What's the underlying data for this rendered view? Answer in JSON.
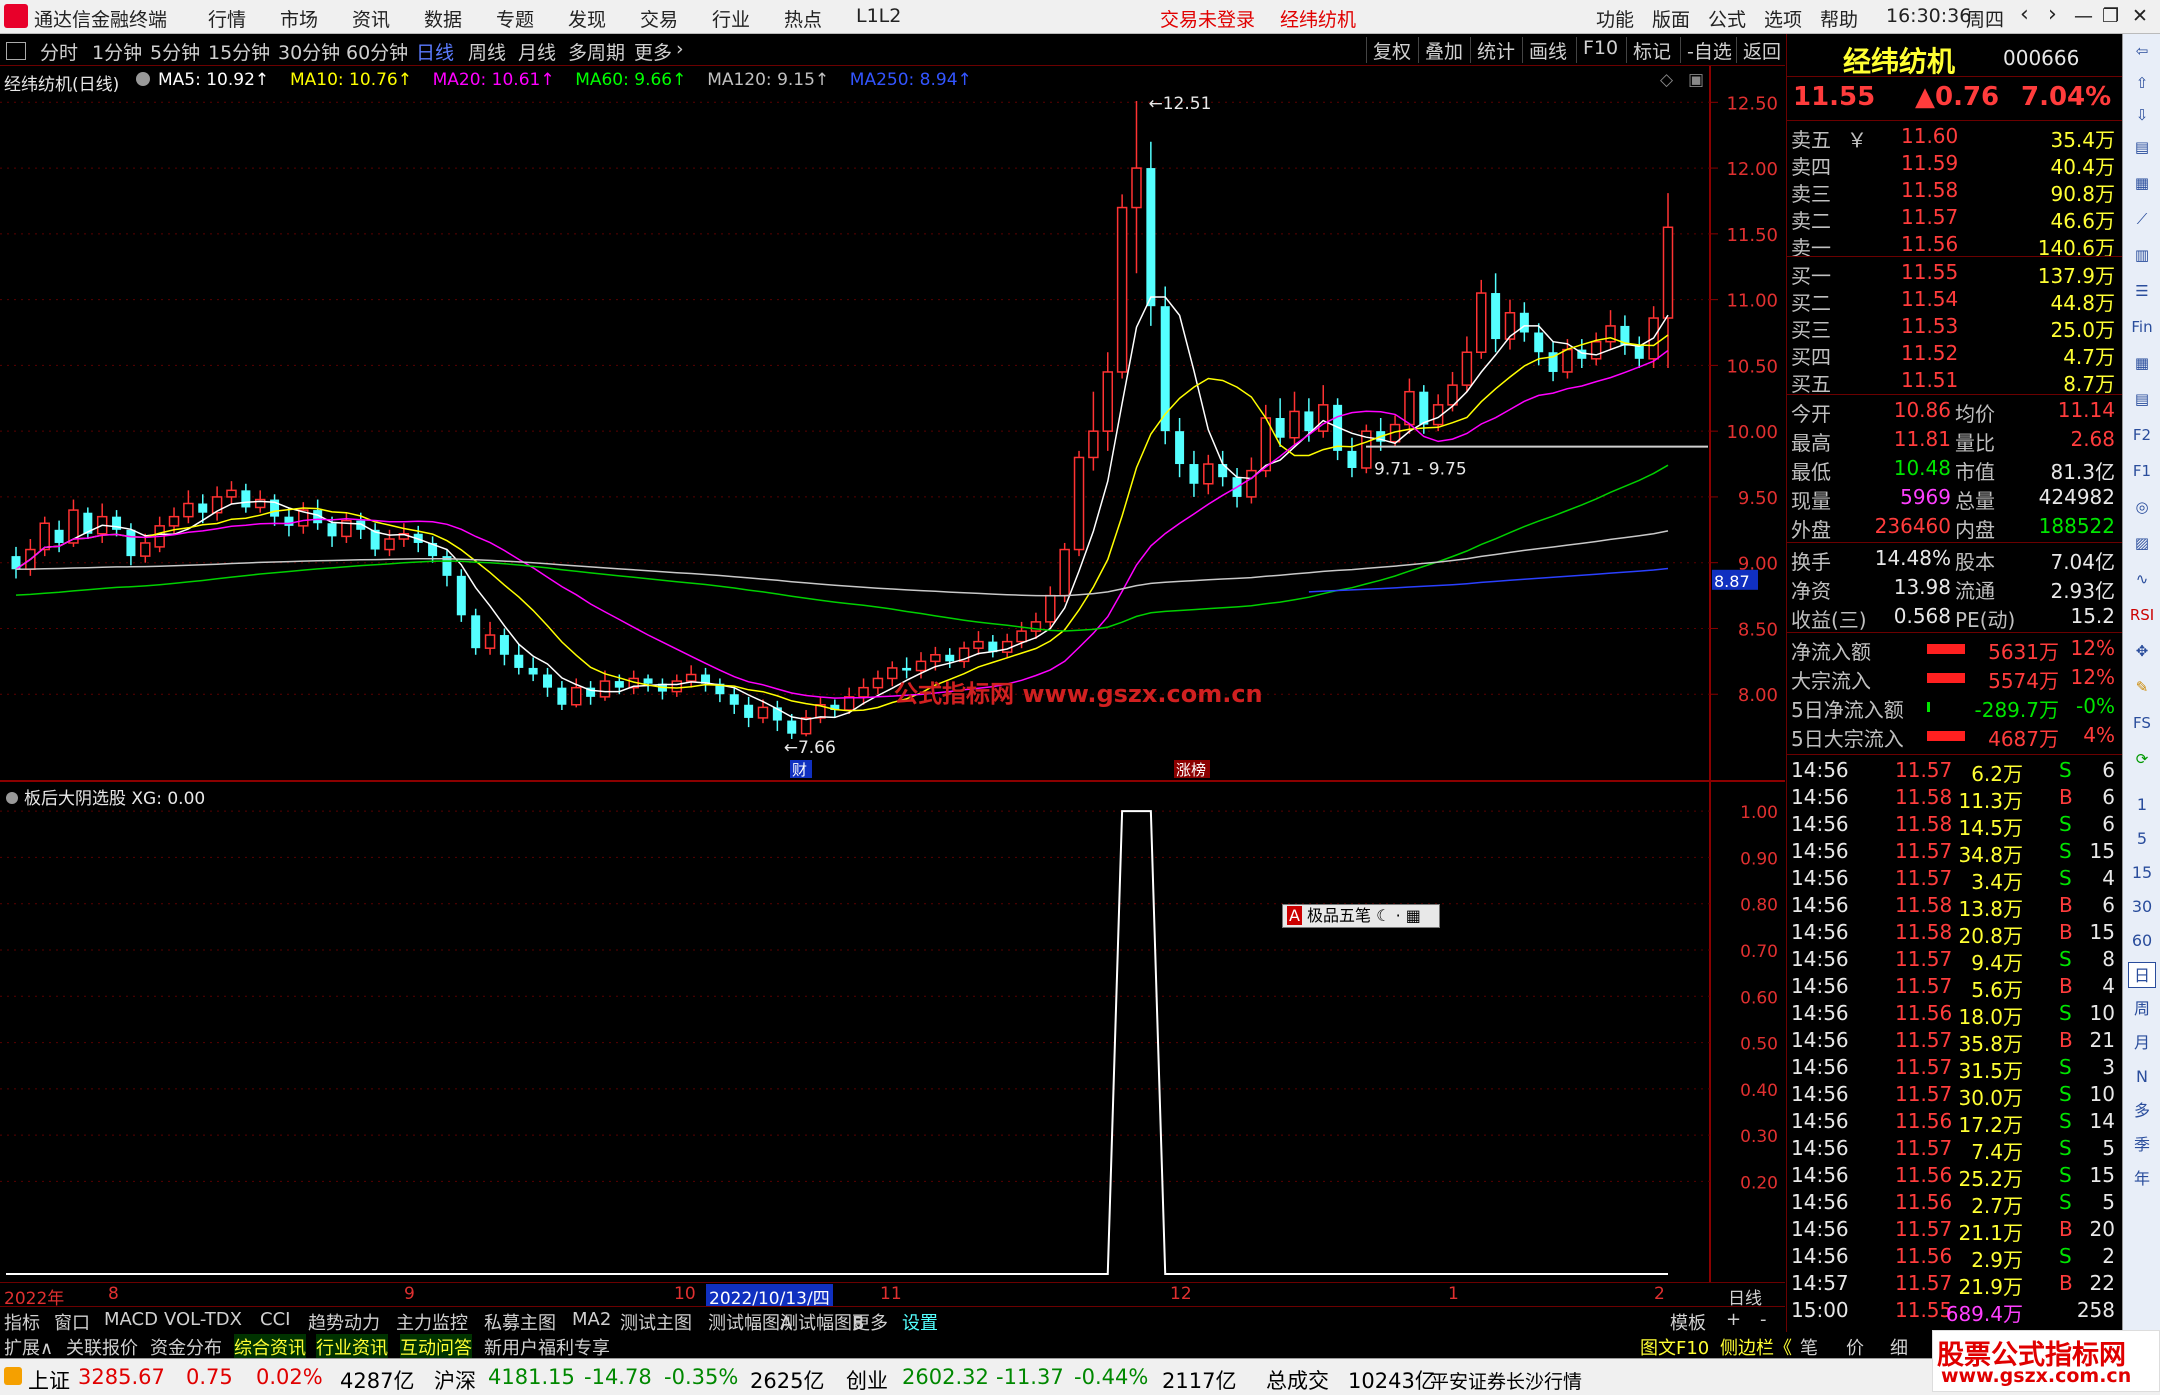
{
  "menubar": {
    "app_title": "通达信金融终端",
    "items": [
      "行情",
      "市场",
      "资讯",
      "数据",
      "专题",
      "发现",
      "交易",
      "行业",
      "热点",
      "L1L2"
    ],
    "trade_status": "交易未登录",
    "current_stock": "经纬纺机",
    "right_items": [
      "功能",
      "版面",
      "公式",
      "选项",
      "帮助"
    ],
    "time": "16:30:36",
    "weekday": "周四"
  },
  "periodbar": {
    "periods": [
      "分时",
      "1分钟",
      "5分钟",
      "15分钟",
      "30分钟",
      "60分钟",
      "日线",
      "周线",
      "月线",
      "多周期",
      "更多"
    ],
    "active": "日线",
    "tools": [
      "复权",
      "叠加",
      "统计",
      "画线",
      "F10",
      "标记",
      "-自选",
      "返回"
    ]
  },
  "main_chart": {
    "legend_name": "经纬纺机(日线)",
    "ma": [
      {
        "label": "MA5: 10.92",
        "color": "#ffffff"
      },
      {
        "label": "MA10: 10.76",
        "color": "#ffff00"
      },
      {
        "label": "MA20: 10.61",
        "color": "#ff00ff"
      },
      {
        "label": "MA60: 9.66",
        "color": "#00ff00"
      },
      {
        "label": "MA120: 9.15",
        "color": "#c0c0c0"
      },
      {
        "label": "MA250: 8.94",
        "color": "#3355ff"
      }
    ],
    "y_ticks": [
      "12.50",
      "12.00",
      "11.50",
      "11.00",
      "10.50",
      "10.00",
      "9.50",
      "9.00",
      "8.50",
      "8.00"
    ],
    "high_label": "12.51",
    "low_label": "7.66",
    "range_label": "9.71 - 9.75",
    "current_tag": "8.87",
    "marker_cai": "财",
    "marker_zhangbang": "涨榜",
    "watermark_text": "公式指标网 www.gszx.com.cn"
  },
  "sub_chart": {
    "legend": "板后大阴选股 XG: 0.00",
    "y_ticks": [
      "1.00",
      "0.90",
      "0.80",
      "0.70",
      "0.60",
      "0.50",
      "0.40",
      "0.30",
      "0.20"
    ],
    "ime_label": "极品五笔"
  },
  "x_axis": {
    "labels": [
      "2022年",
      "8",
      "9",
      "10",
      "11",
      "12",
      "1",
      "2"
    ],
    "cursor_date": "2022/10/13/四",
    "period_label": "日线"
  },
  "chart_data": {
    "type": "candlestick",
    "ylim": [
      7.5,
      12.7
    ],
    "candles": [
      [
        9.05,
        8.95,
        9.12,
        8.88
      ],
      [
        8.95,
        9.1,
        9.18,
        8.9
      ],
      [
        9.1,
        9.3,
        9.35,
        9.05
      ],
      [
        9.25,
        9.15,
        9.32,
        9.08
      ],
      [
        9.15,
        9.4,
        9.48,
        9.12
      ],
      [
        9.38,
        9.22,
        9.42,
        9.18
      ],
      [
        9.22,
        9.35,
        9.45,
        9.15
      ],
      [
        9.35,
        9.25,
        9.4,
        9.2
      ],
      [
        9.25,
        9.05,
        9.3,
        8.98
      ],
      [
        9.05,
        9.15,
        9.22,
        9.0
      ],
      [
        9.12,
        9.28,
        9.35,
        9.08
      ],
      [
        9.28,
        9.35,
        9.42,
        9.22
      ],
      [
        9.35,
        9.45,
        9.55,
        9.3
      ],
      [
        9.45,
        9.38,
        9.52,
        9.3
      ],
      [
        9.38,
        9.5,
        9.58,
        9.32
      ],
      [
        9.5,
        9.55,
        9.62,
        9.45
      ],
      [
        9.55,
        9.42,
        9.6,
        9.38
      ],
      [
        9.42,
        9.48,
        9.55,
        9.38
      ],
      [
        9.48,
        9.35,
        9.52,
        9.28
      ],
      [
        9.35,
        9.28,
        9.42,
        9.2
      ],
      [
        9.28,
        9.4,
        9.46,
        9.22
      ],
      [
        9.4,
        9.3,
        9.48,
        9.25
      ],
      [
        9.3,
        9.2,
        9.35,
        9.12
      ],
      [
        9.2,
        9.32,
        9.38,
        9.15
      ],
      [
        9.32,
        9.25,
        9.38,
        9.18
      ],
      [
        9.25,
        9.1,
        9.3,
        9.05
      ],
      [
        9.1,
        9.18,
        9.25,
        9.05
      ],
      [
        9.18,
        9.22,
        9.3,
        9.12
      ],
      [
        9.22,
        9.15,
        9.28,
        9.08
      ],
      [
        9.15,
        9.05,
        9.2,
        9.0
      ],
      [
        9.05,
        8.9,
        9.1,
        8.82
      ],
      [
        8.9,
        8.6,
        8.95,
        8.55
      ],
      [
        8.6,
        8.35,
        8.65,
        8.3
      ],
      [
        8.35,
        8.45,
        8.55,
        8.3
      ],
      [
        8.45,
        8.3,
        8.5,
        8.22
      ],
      [
        8.3,
        8.2,
        8.38,
        8.15
      ],
      [
        8.2,
        8.15,
        8.28,
        8.1
      ],
      [
        8.15,
        8.05,
        8.2,
        7.98
      ],
      [
        8.05,
        7.92,
        8.1,
        7.88
      ],
      [
        7.92,
        8.05,
        8.12,
        7.9
      ],
      [
        8.05,
        7.98,
        8.1,
        7.92
      ],
      [
        7.98,
        8.1,
        8.18,
        7.95
      ],
      [
        8.1,
        8.05,
        8.15,
        8.0
      ],
      [
        8.05,
        8.12,
        8.18,
        8.0
      ],
      [
        8.12,
        8.08,
        8.15,
        8.02
      ],
      [
        8.08,
        8.02,
        8.12,
        7.96
      ],
      [
        8.02,
        8.1,
        8.15,
        7.98
      ],
      [
        8.1,
        8.15,
        8.22,
        8.05
      ],
      [
        8.15,
        8.08,
        8.2,
        8.02
      ],
      [
        8.08,
        8.0,
        8.12,
        7.94
      ],
      [
        8.0,
        7.92,
        8.05,
        7.85
      ],
      [
        7.92,
        7.82,
        7.98,
        7.75
      ],
      [
        7.82,
        7.9,
        7.96,
        7.78
      ],
      [
        7.9,
        7.8,
        7.95,
        7.72
      ],
      [
        7.8,
        7.7,
        7.85,
        7.66
      ],
      [
        7.7,
        7.82,
        7.88,
        7.68
      ],
      [
        7.82,
        7.92,
        7.98,
        7.78
      ],
      [
        7.92,
        7.88,
        7.96,
        7.82
      ],
      [
        7.88,
        7.98,
        8.05,
        7.85
      ],
      [
        7.98,
        8.05,
        8.12,
        7.92
      ],
      [
        8.05,
        8.12,
        8.18,
        8.0
      ],
      [
        8.12,
        8.2,
        8.25,
        8.06
      ],
      [
        8.2,
        8.18,
        8.28,
        8.12
      ],
      [
        8.18,
        8.25,
        8.32,
        8.12
      ],
      [
        8.25,
        8.3,
        8.36,
        8.18
      ],
      [
        8.3,
        8.25,
        8.35,
        8.2
      ],
      [
        8.25,
        8.35,
        8.4,
        8.2
      ],
      [
        8.35,
        8.4,
        8.48,
        8.3
      ],
      [
        8.4,
        8.32,
        8.45,
        8.28
      ],
      [
        8.32,
        8.4,
        8.46,
        8.28
      ],
      [
        8.4,
        8.48,
        8.55,
        8.35
      ],
      [
        8.48,
        8.55,
        8.62,
        8.42
      ],
      [
        8.55,
        8.75,
        8.82,
        8.5
      ],
      [
        8.75,
        9.1,
        9.15,
        8.7
      ],
      [
        9.1,
        9.8,
        9.85,
        9.05
      ],
      [
        9.8,
        10.0,
        10.3,
        9.7
      ],
      [
        10.0,
        10.45,
        10.6,
        9.85
      ],
      [
        10.45,
        11.7,
        11.8,
        10.4
      ],
      [
        11.7,
        12.0,
        12.51,
        11.2
      ],
      [
        12.0,
        10.95,
        12.2,
        10.8
      ],
      [
        10.95,
        10.0,
        11.1,
        9.9
      ],
      [
        10.0,
        9.75,
        10.1,
        9.65
      ],
      [
        9.75,
        9.6,
        9.85,
        9.5
      ],
      [
        9.6,
        9.75,
        9.82,
        9.52
      ],
      [
        9.75,
        9.65,
        9.85,
        9.58
      ],
      [
        9.65,
        9.5,
        9.72,
        9.42
      ],
      [
        9.5,
        9.7,
        9.8,
        9.45
      ],
      [
        9.7,
        10.1,
        10.2,
        9.65
      ],
      [
        10.1,
        9.95,
        10.25,
        9.88
      ],
      [
        9.95,
        10.15,
        10.3,
        9.9
      ],
      [
        10.15,
        10.0,
        10.25,
        9.92
      ],
      [
        10.0,
        10.2,
        10.35,
        9.95
      ],
      [
        10.2,
        9.85,
        10.25,
        9.78
      ],
      [
        9.85,
        9.72,
        9.95,
        9.65
      ],
      [
        9.72,
        10.0,
        10.05,
        9.68
      ],
      [
        10.0,
        9.92,
        10.1,
        9.85
      ],
      [
        9.92,
        10.05,
        10.12,
        9.88
      ],
      [
        10.05,
        10.3,
        10.4,
        9.98
      ],
      [
        10.3,
        10.05,
        10.35,
        9.98
      ],
      [
        10.05,
        10.2,
        10.28,
        10.0
      ],
      [
        10.2,
        10.35,
        10.45,
        10.15
      ],
      [
        10.35,
        10.6,
        10.72,
        10.3
      ],
      [
        10.6,
        11.05,
        11.15,
        10.55
      ],
      [
        11.05,
        10.7,
        11.2,
        10.6
      ],
      [
        10.7,
        10.9,
        11.0,
        10.62
      ],
      [
        10.9,
        10.75,
        10.98,
        10.68
      ],
      [
        10.75,
        10.6,
        10.82,
        10.5
      ],
      [
        10.6,
        10.45,
        10.68,
        10.38
      ],
      [
        10.45,
        10.62,
        10.7,
        10.4
      ],
      [
        10.62,
        10.55,
        10.7,
        10.48
      ],
      [
        10.55,
        10.68,
        10.75,
        10.5
      ],
      [
        10.68,
        10.8,
        10.92,
        10.62
      ],
      [
        10.8,
        10.65,
        10.88,
        10.58
      ],
      [
        10.65,
        10.55,
        10.72,
        10.48
      ],
      [
        10.55,
        10.86,
        10.95,
        10.48
      ],
      [
        10.86,
        11.55,
        11.81,
        10.48
      ]
    ]
  },
  "quote": {
    "name": "经纬纺机",
    "code": "000666",
    "price": "11.55",
    "change": "▲0.76",
    "pct": "7.04%",
    "asks": [
      {
        "label": "卖五",
        "price": "11.60",
        "vol": "35.4万"
      },
      {
        "label": "卖四",
        "price": "11.59",
        "vol": "40.4万"
      },
      {
        "label": "卖三",
        "price": "11.58",
        "vol": "90.8万"
      },
      {
        "label": "卖二",
        "price": "11.57",
        "vol": "46.6万"
      },
      {
        "label": "卖一",
        "price": "11.56",
        "vol": "140.6万"
      }
    ],
    "ask_currency": "￥",
    "bids": [
      {
        "label": "买一",
        "price": "11.55",
        "vol": "137.9万"
      },
      {
        "label": "买二",
        "price": "11.54",
        "vol": "44.8万"
      },
      {
        "label": "买三",
        "price": "11.53",
        "vol": "25.0万"
      },
      {
        "label": "买四",
        "price": "11.52",
        "vol": "4.7万"
      },
      {
        "label": "买五",
        "price": "11.51",
        "vol": "8.7万"
      }
    ],
    "stats": [
      [
        {
          "k": "今开",
          "v": "10.86",
          "c": "red"
        },
        {
          "k": "均价",
          "v": "11.14",
          "c": "red"
        }
      ],
      [
        {
          "k": "最高",
          "v": "11.81",
          "c": "red"
        },
        {
          "k": "量比",
          "v": "2.68",
          "c": "red"
        }
      ],
      [
        {
          "k": "最低",
          "v": "10.48",
          "c": "grn"
        },
        {
          "k": "市值",
          "v": "81.3亿",
          "c": "wht"
        }
      ],
      [
        {
          "k": "现量",
          "v": "5969",
          "c": "mag"
        },
        {
          "k": "总量",
          "v": "424982",
          "c": "wht"
        }
      ],
      [
        {
          "k": "外盘",
          "v": "236460",
          "c": "red"
        },
        {
          "k": "内盘",
          "v": "188522",
          "c": "grn"
        }
      ]
    ],
    "stats2": [
      [
        {
          "k": "换手",
          "v": "14.48%"
        },
        {
          "k": "股本",
          "v": "7.04亿"
        }
      ],
      [
        {
          "k": "净资",
          "v": "13.98"
        },
        {
          "k": "流通",
          "v": "2.93亿"
        }
      ],
      [
        {
          "k": "收益(三)",
          "v": "0.568"
        },
        {
          "k": "PE(动)",
          "v": "15.2"
        }
      ]
    ],
    "flows": [
      {
        "k": "净流入额",
        "v": "5631万",
        "p": "12%",
        "c": "red"
      },
      {
        "k": "大宗流入",
        "v": "5574万",
        "p": "12%",
        "c": "red"
      },
      {
        "k": "5日净流入额",
        "v": "-289.7万",
        "p": "-0%",
        "c": "grn"
      },
      {
        "k": "5日大宗流入",
        "v": "4687万",
        "p": "4%",
        "c": "red"
      }
    ],
    "ticks": [
      [
        "14:56",
        "11.57",
        "6.2万",
        "S",
        "6"
      ],
      [
        "14:56",
        "11.58",
        "11.3万",
        "B",
        "6"
      ],
      [
        "14:56",
        "11.58",
        "14.5万",
        "S",
        "6"
      ],
      [
        "14:56",
        "11.57",
        "34.8万",
        "S",
        "15"
      ],
      [
        "14:56",
        "11.57",
        "3.4万",
        "S",
        "4"
      ],
      [
        "14:56",
        "11.58",
        "13.8万",
        "B",
        "6"
      ],
      [
        "14:56",
        "11.58",
        "20.8万",
        "B",
        "15"
      ],
      [
        "14:56",
        "11.57",
        "9.4万",
        "S",
        "8"
      ],
      [
        "14:56",
        "11.57",
        "5.6万",
        "B",
        "4"
      ],
      [
        "14:56",
        "11.56",
        "18.0万",
        "S",
        "10"
      ],
      [
        "14:56",
        "11.57",
        "35.8万",
        "B",
        "21"
      ],
      [
        "14:56",
        "11.57",
        "31.5万",
        "S",
        "3"
      ],
      [
        "14:56",
        "11.57",
        "30.0万",
        "S",
        "10"
      ],
      [
        "14:56",
        "11.56",
        "17.2万",
        "S",
        "14"
      ],
      [
        "14:56",
        "11.57",
        "7.4万",
        "S",
        "5"
      ],
      [
        "14:56",
        "11.56",
        "25.2万",
        "S",
        "15"
      ],
      [
        "14:56",
        "11.56",
        "2.7万",
        "S",
        "5"
      ],
      [
        "14:56",
        "11.57",
        "21.1万",
        "B",
        "20"
      ],
      [
        "14:56",
        "11.56",
        "2.9万",
        "S",
        "2"
      ],
      [
        "14:57",
        "11.57",
        "21.9万",
        "B",
        "22"
      ],
      [
        "15:00",
        "11.55",
        "689.4万",
        "",
        "258"
      ]
    ]
  },
  "side_icons": [
    "1",
    "5",
    "15",
    "30",
    "60",
    "日",
    "周",
    "月",
    "N",
    "多",
    "季",
    "年"
  ],
  "bottombar1": {
    "tabs": [
      "指标",
      "窗口",
      "MACD",
      "VOL-TDX",
      "CCI",
      "趋势动力",
      "主力监控",
      "私募主图",
      "MA2",
      "测试主图",
      "测试幅图A",
      "测试幅图B",
      "更多",
      "设置"
    ],
    "right": [
      "模板",
      "+",
      "-"
    ]
  },
  "bottombar2": {
    "tabs": [
      "扩展∧",
      "关联报价",
      "资金分布",
      "综合资讯",
      "行业资讯",
      "互动问答",
      "新用户福利专享"
    ],
    "right": [
      "图文F10",
      "侧边栏《",
      "笔",
      "价",
      "细"
    ]
  },
  "statusbar": {
    "sh": {
      "name": "上证",
      "val": "3285.67",
      "chg": "0.75",
      "pct": "0.02%",
      "amt": "4287亿"
    },
    "hs": {
      "name": "沪深",
      "val": "4181.15",
      "chg": "-14.78",
      "pct": "-0.35%",
      "amt": "2625亿"
    },
    "cy": {
      "name": "创业",
      "val": "2602.32",
      "chg": "-11.37",
      "pct": "-0.44%",
      "amt": "2117亿"
    },
    "total_label": "总成交",
    "total_val": "10243亿",
    "broker": "平安证券长沙行情"
  },
  "watermark": {
    "line1": "股票公式指标网",
    "line2": "www.gszx.com.cn"
  }
}
